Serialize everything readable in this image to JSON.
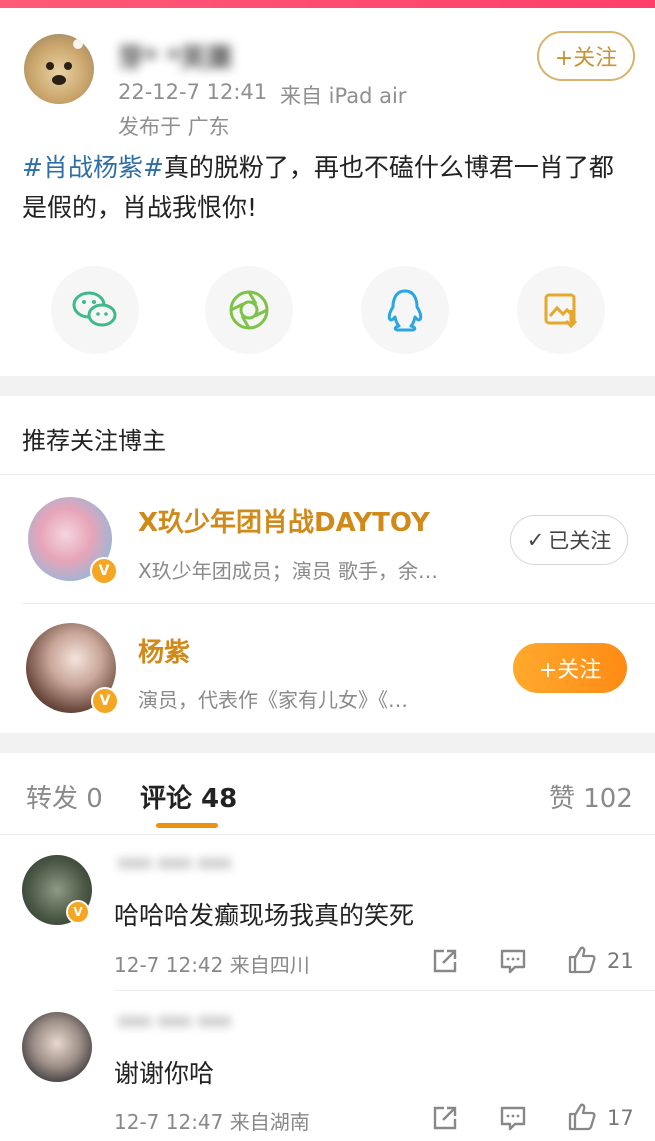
{
  "post": {
    "author_name": "芽* *芙蕖",
    "time": "22-12-7 12:41",
    "source": "来自 iPad air",
    "location": "发布于 广东",
    "follow_label": "+关注",
    "hashtag": "#肖战杨紫#",
    "text": "真的脱粉了，再也不磕什么博君一肖了都是假的，肖战我恨你!"
  },
  "share": {
    "icons": [
      "wechat-icon",
      "moments-icon",
      "qq-icon",
      "save-image-icon"
    ]
  },
  "recommend": {
    "title": "推荐关注博主",
    "users": [
      {
        "name": "X玖少年团肖战DAYTOY",
        "desc": "X玖少年团成员；演员 歌手，余…",
        "button": "已关注"
      },
      {
        "name": "杨紫",
        "desc": "演员，代表作《家有儿女》《…",
        "button": "+关注"
      }
    ]
  },
  "tabs": {
    "repost": "转发 0",
    "comment": "评论 48",
    "like": "赞 102"
  },
  "comments": [
    {
      "user": "*** *** ***",
      "text": "哈哈哈发癫现场我真的笑死",
      "meta": "12-7 12:42 来自四川",
      "likes": "21"
    },
    {
      "user": "*** *** ***",
      "text": "谢谢你哈",
      "meta": "12-7 12:47 来自湖南",
      "likes": "17"
    }
  ],
  "colors": {
    "accent_orange": "#ff8a14",
    "hashtag_blue": "#2f6ea5",
    "name_gold": "#d08a1a"
  }
}
